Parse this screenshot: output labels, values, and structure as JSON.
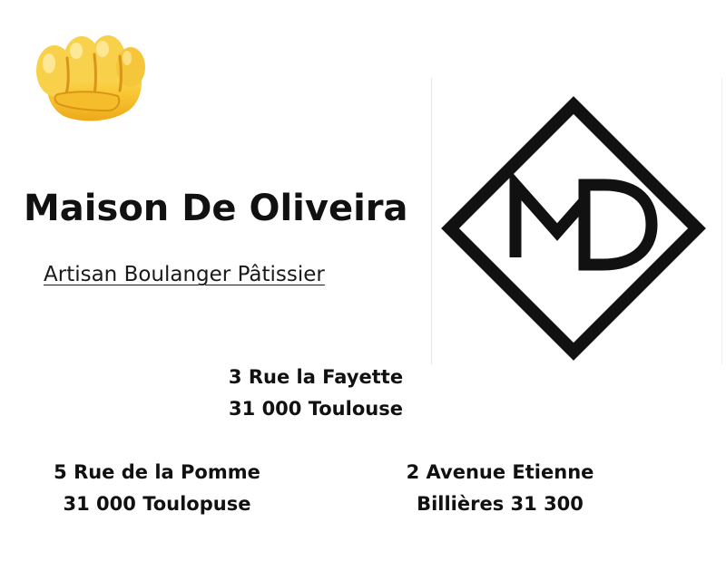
{
  "header": {
    "title": "Maison De Oliveira",
    "subtitle": "Artisan Boulanger Pâtissier",
    "emoji_icon": "raised-fist-icon"
  },
  "logo": {
    "icon": "md-diamond-logo",
    "text": "MD"
  },
  "addresses": [
    {
      "line1": "3 Rue la Fayette",
      "line2": "31 000 Toulouse"
    },
    {
      "line1": "5 Rue de la Pomme",
      "line2": "31 000 Toulopuse"
    },
    {
      "line1": "2 Avenue Etienne",
      "line2": "Billières 31 300"
    }
  ],
  "colors": {
    "text": "#111111",
    "emoji_yellow": "#f7c531"
  }
}
